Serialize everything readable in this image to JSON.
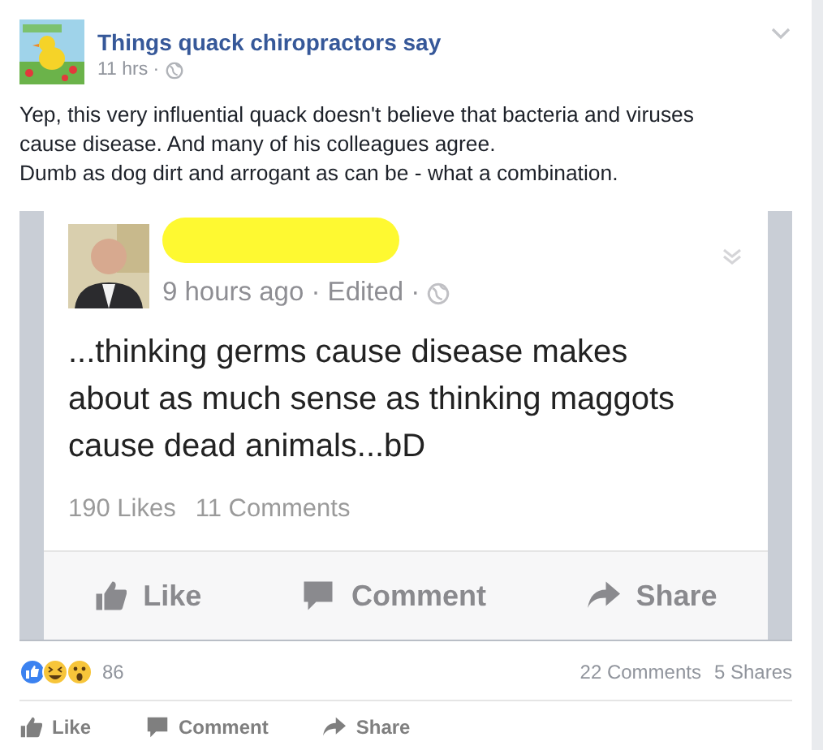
{
  "post": {
    "page_name": "Things quack chiropractors say",
    "time": "11 hrs ·",
    "text": [
      "Yep, this very influential quack doesn't believe that bacteria and viruses cause disease. And many of his colleagues agree.",
      "Dumb as dog dirt and arrogant as can be - what a combination."
    ]
  },
  "shared_screenshot": {
    "meta": "9 hours ago · Edited ·",
    "text": "...thinking germs cause disease makes about as much sense as thinking maggots cause dead animals...bD",
    "stats": [
      "190 Likes",
      "11 Comments"
    ],
    "actions": [
      {
        "kind": "like",
        "label": "Like"
      },
      {
        "kind": "comment",
        "label": "Comment"
      },
      {
        "kind": "share",
        "label": "Share"
      }
    ]
  },
  "reactions": {
    "count": "86",
    "comments": "22 Comments",
    "shares": "5 Shares"
  },
  "actions": [
    {
      "kind": "like",
      "label": "Like"
    },
    {
      "kind": "comment",
      "label": "Comment"
    },
    {
      "kind": "share",
      "label": "Share"
    }
  ]
}
